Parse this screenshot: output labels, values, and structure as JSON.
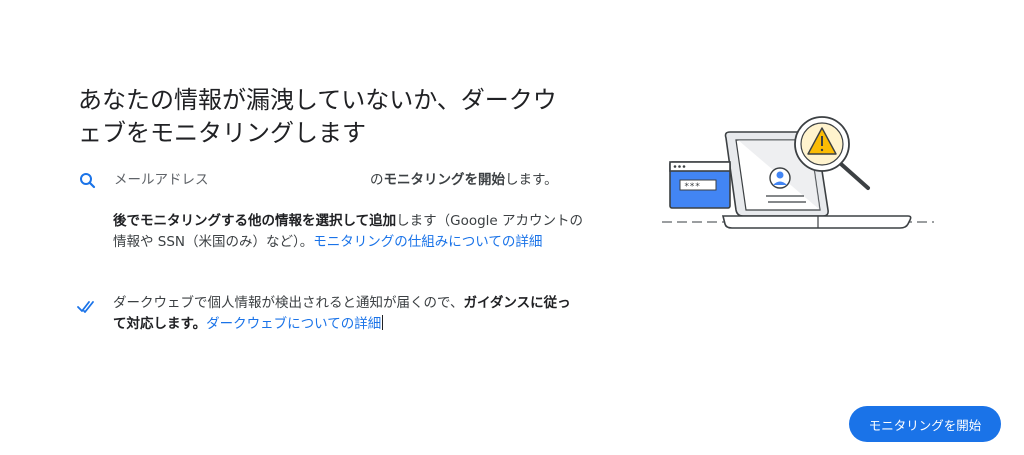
{
  "heading": {
    "line1": "あなたの情報が漏洩していないか、ダークウ",
    "line2": "ェブをモニタリングします"
  },
  "email_row": {
    "icon": "search-icon",
    "label": "メールアドレス",
    "suffix_pre": "の",
    "suffix_bold": "モニタリングを開始",
    "suffix_post": "します。"
  },
  "additional_info": {
    "bold1": "後でモニタリングする他の情報を選択して追加",
    "text1": "します（Google アカウントの情報や SSN（米国のみ）など）。",
    "link": "モニタリングの仕組みについての詳細"
  },
  "dark_web_row": {
    "icon": "double-check-icon",
    "text1": "ダークウェブで個人情報が検出されると通知が届くので、",
    "bold1": "ガイダンスに従って対応します。",
    "link": "ダークウェブについての詳細"
  },
  "illustration": {
    "password_mask": "***",
    "icon": "laptop-warning-illustration"
  },
  "footer": {
    "start_button": "モニタリングを開始"
  },
  "colors": {
    "accent": "#1a73e8",
    "warning": "#fbbc04",
    "illustration_blue": "#4285f4"
  }
}
